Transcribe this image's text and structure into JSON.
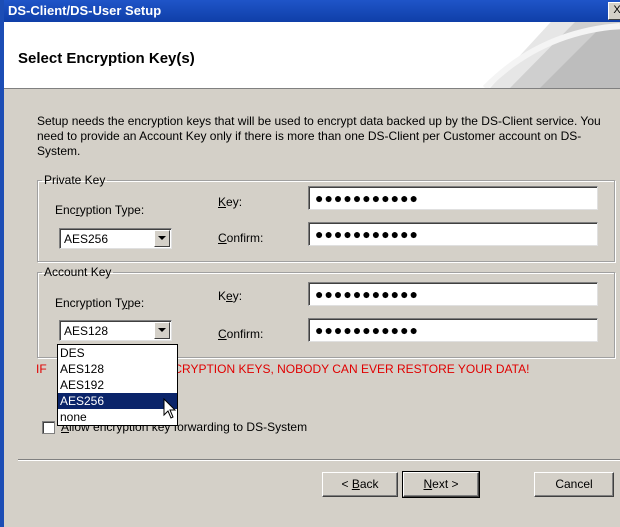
{
  "window": {
    "title": "DS-Client/DS-User Setup",
    "close_glyph": "X"
  },
  "header": {
    "title": "Select Encryption Key(s)"
  },
  "intro": {
    "text": "Setup needs the encryption keys that will be used to encrypt data backed up by the DS-Client service. You need to provide an Account Key only if there is more than one DS-Client per Customer account on DS-System."
  },
  "private_key": {
    "legend": "Private Key",
    "type_label_pre": "Enc",
    "type_label_u": "r",
    "type_label_post": "yption Type:",
    "type_value": "AES256",
    "key_label_u": "K",
    "key_label_post": "ey:",
    "key_value": "●●●●●●●●●●●",
    "confirm_label_u": "C",
    "confirm_label_post": "onfirm:",
    "confirm_value": "●●●●●●●●●●●"
  },
  "account_key": {
    "legend": "Account Key",
    "type_label_pre": "Encryption T",
    "type_label_u": "y",
    "type_label_post": "pe:",
    "type_value": "AES128",
    "key_label_pre": "K",
    "key_label_u": "e",
    "key_label_post": "y:",
    "key_value": "●●●●●●●●●●●",
    "confirm_label_u": "C",
    "confirm_label_post": "onfirm:",
    "confirm_value": "●●●●●●●●●●●"
  },
  "dropdown": {
    "options": [
      "DES",
      "AES128",
      "AES192",
      "AES256",
      "none"
    ],
    "highlighted": "AES256"
  },
  "warning": {
    "prefix": "IF",
    "suffix": "NCRYPTION KEYS, NOBODY CAN EVER RESTORE YOUR DATA!"
  },
  "forwarding": {
    "label_u": "A",
    "label_visible": "llow encryption key forwarding to DS-System",
    "checked": false
  },
  "buttons": {
    "back": {
      "pre": "< ",
      "u": "B",
      "post": "ack"
    },
    "next": {
      "u": "N",
      "post": "ext >"
    },
    "cancel": "Cancel"
  },
  "colors": {
    "title_bar": "#1f55c8",
    "warning": "#e00000",
    "selection": "#0a246a",
    "dialog": "#d4d0c8"
  }
}
